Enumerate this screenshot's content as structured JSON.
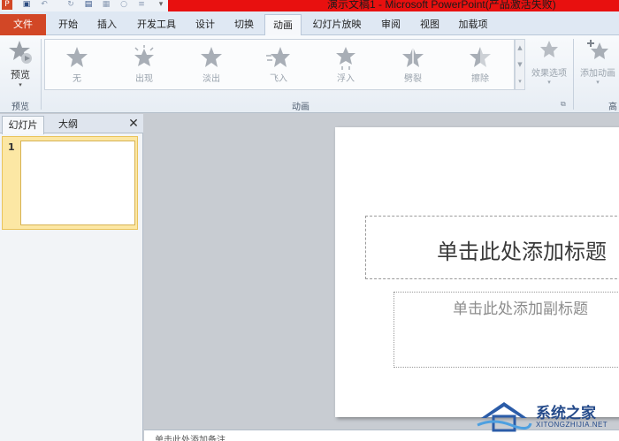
{
  "window": {
    "title": "演示文稿1 - Microsoft PowerPoint(产品激活失败)"
  },
  "ribbon_tabs": {
    "file": "文件",
    "tabs": [
      {
        "label": "开始"
      },
      {
        "label": "插入"
      },
      {
        "label": "开发工具"
      },
      {
        "label": "设计"
      },
      {
        "label": "切换"
      },
      {
        "label": "动画"
      },
      {
        "label": "幻灯片放映"
      },
      {
        "label": "审阅"
      },
      {
        "label": "视图"
      },
      {
        "label": "加载项"
      }
    ],
    "active": "动画"
  },
  "ribbon": {
    "preview": {
      "button_label": "预览",
      "group_label": "预览"
    },
    "animations": {
      "group_label": "动画",
      "items": [
        {
          "label": "无"
        },
        {
          "label": "出现"
        },
        {
          "label": "淡出"
        },
        {
          "label": "飞入"
        },
        {
          "label": "浮入"
        },
        {
          "label": "劈裂"
        },
        {
          "label": "擦除"
        }
      ]
    },
    "effect_options": {
      "label": "效果选项"
    },
    "add_animation": {
      "label": "添加动画"
    },
    "advanced_group_label": "高"
  },
  "left_pane": {
    "tabs": [
      {
        "label": "幻灯片"
      },
      {
        "label": "大纲"
      }
    ],
    "close_symbol": "✕",
    "slide_number": "1"
  },
  "slide": {
    "title_placeholder": "单击此处添加标题",
    "subtitle_placeholder": "单击此处添加副标题"
  },
  "notes": {
    "text": "单击此处添加备注"
  },
  "watermark": {
    "text": "系统之家",
    "url": "XITONGZHIJIA.NET"
  },
  "colors": {
    "file_tab": "#d24726",
    "title_bar_error": "#e8100f",
    "selected_slide": "#fce7a4"
  }
}
